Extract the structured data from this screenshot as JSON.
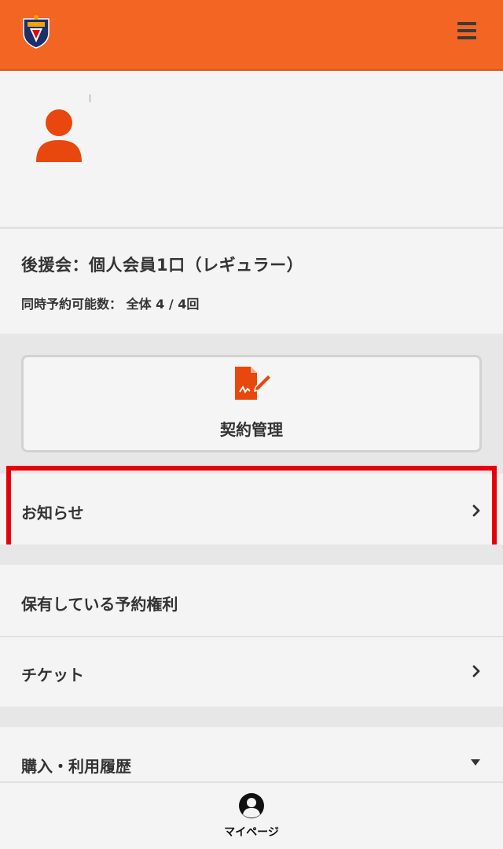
{
  "header": {
    "logo_icon": "club-crest-icon",
    "menu_icon": "hamburger-menu-icon"
  },
  "profile": {
    "avatar_icon": "user-avatar-icon"
  },
  "membership": {
    "type_label": "後援会：個人会員1口（レギュラー）",
    "reserve_count": "同時予約可能数： 全体 4 / 4回"
  },
  "contract": {
    "label": "契約管理",
    "icon": "contract-edit-icon"
  },
  "menu": {
    "news_label": "お知らせ",
    "rights_label": "保有している予約権利",
    "ticket_label": "チケット",
    "history_label": "購入・利用履歴"
  },
  "bottom_nav": {
    "mypage_label": "マイページ",
    "mypage_icon": "account-circle-icon"
  },
  "colors": {
    "brand": "#f26522",
    "highlight": "#e8000b",
    "avatar": "#e8470e"
  }
}
